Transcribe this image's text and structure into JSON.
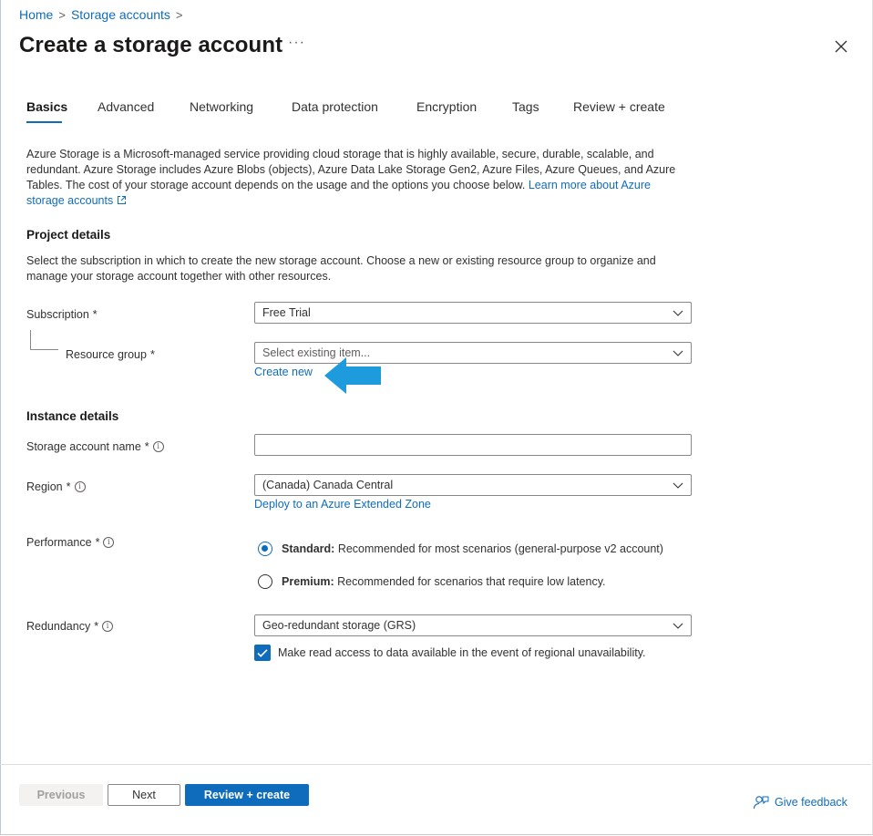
{
  "breadcrumb": {
    "home": "Home",
    "storage_accounts": "Storage accounts",
    "separator": ">"
  },
  "header": {
    "title": "Create a storage account",
    "more": "···"
  },
  "tabs": [
    {
      "label": "Basics",
      "active": true
    },
    {
      "label": "Advanced"
    },
    {
      "label": "Networking"
    },
    {
      "label": "Data protection"
    },
    {
      "label": "Encryption"
    },
    {
      "label": "Tags"
    },
    {
      "label": "Review + create"
    }
  ],
  "description": {
    "text": "Azure Storage is a Microsoft-managed service providing cloud storage that is highly available, secure, durable, scalable, and redundant. Azure Storage includes Azure Blobs (objects), Azure Data Lake Storage Gen2, Azure Files, Azure Queues, and Azure Tables. The cost of your storage account depends on the usage and the options you choose below.",
    "link": "Learn more about Azure storage accounts"
  },
  "project_details": {
    "heading": "Project details",
    "text": "Select the subscription in which to create the new storage account. Choose a new or existing resource group to organize and manage your storage account together with other resources.",
    "subscription_label": "Subscription",
    "subscription_value": "Free Trial",
    "resource_group_label": "Resource group",
    "resource_group_placeholder": "Select existing item...",
    "create_new": "Create new"
  },
  "instance_details": {
    "heading": "Instance details",
    "storage_name_label": "Storage account name",
    "storage_name_value": "",
    "region_label": "Region",
    "region_value": "(Canada) Canada Central",
    "extended_zone_link": "Deploy to an Azure Extended Zone",
    "performance_label": "Performance",
    "performance_options": [
      {
        "title": "Standard:",
        "desc": "Recommended for most scenarios (general-purpose v2 account)",
        "selected": true
      },
      {
        "title": "Premium:",
        "desc": "Recommended for scenarios that require low latency.",
        "selected": false
      }
    ],
    "redundancy_label": "Redundancy",
    "redundancy_value": "Geo-redundant storage (GRS)",
    "read_access_label": "Make read access to data available in the event of regional unavailability.",
    "read_access_checked": true
  },
  "required_marker": "*",
  "info_glyph": "i",
  "footer": {
    "previous": "Previous",
    "next": "Next",
    "review_create": "Review + create",
    "feedback": "Give feedback"
  },
  "colors": {
    "accent": "#0f6cbd",
    "arrow": "#1e9bdc",
    "required": "#a4262c"
  }
}
